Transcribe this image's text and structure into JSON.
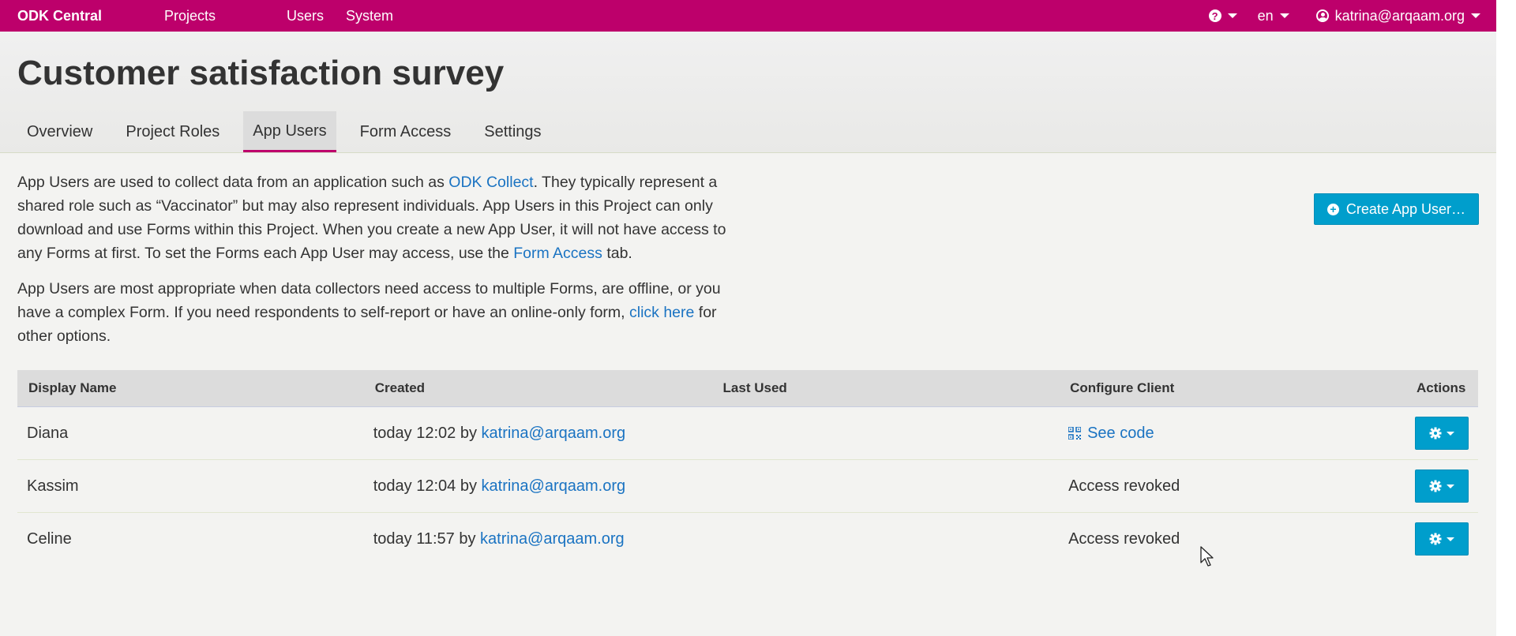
{
  "navbar": {
    "brand": "ODK Central",
    "links": [
      "Projects",
      "Users",
      "System"
    ],
    "language": "en",
    "user_email": "katrina@arqaam.org",
    "help_icon": "question-circle-icon",
    "user_icon": "user-circle-icon",
    "color": "#bd006b"
  },
  "page": {
    "title": "Customer satisfaction survey"
  },
  "tabs": [
    {
      "label": "Overview",
      "active": false
    },
    {
      "label": "Project Roles",
      "active": false
    },
    {
      "label": "App Users",
      "active": true
    },
    {
      "label": "Form Access",
      "active": false
    },
    {
      "label": "Settings",
      "active": false
    }
  ],
  "intro": {
    "p1_a": "App Users are used to collect data from an application such as ",
    "p1_link1": "ODK Collect",
    "p1_b": ". They typically represent a shared role such as “Vaccinator” but may also represent individuals. App Users in this Project can only download and use Forms within this Project. When you create a new App User, it will not have access to any Forms at first. To set the Forms each App User may access, use the ",
    "p1_link2": "Form Access",
    "p1_c": " tab.",
    "p2_a": "App Users are most appropriate when data collectors need access to multiple Forms, are offline, or you have a complex Form. If you need respondents to self-report or have an online-only form, ",
    "p2_link": "click here",
    "p2_b": " for other options."
  },
  "create_button": {
    "label": "Create App User…",
    "icon": "plus-circle-icon",
    "color": "#009ecc"
  },
  "table": {
    "headers": [
      "Display Name",
      "Created",
      "Last Used",
      "Configure Client",
      "Actions"
    ],
    "rows": [
      {
        "name": "Diana",
        "created_prefix": "today 12:02 by ",
        "created_by": "katrina@arqaam.org",
        "last_used": "",
        "config": "See code",
        "config_is_link": true
      },
      {
        "name": "Kassim",
        "created_prefix": "today 12:04 by ",
        "created_by": "katrina@arqaam.org",
        "last_used": "",
        "config": "Access revoked",
        "config_is_link": false
      },
      {
        "name": "Celine",
        "created_prefix": "today 11:57 by ",
        "created_by": "katrina@arqaam.org",
        "last_used": "",
        "config": "Access revoked",
        "config_is_link": false
      }
    ],
    "action_icon": "gear-icon"
  }
}
